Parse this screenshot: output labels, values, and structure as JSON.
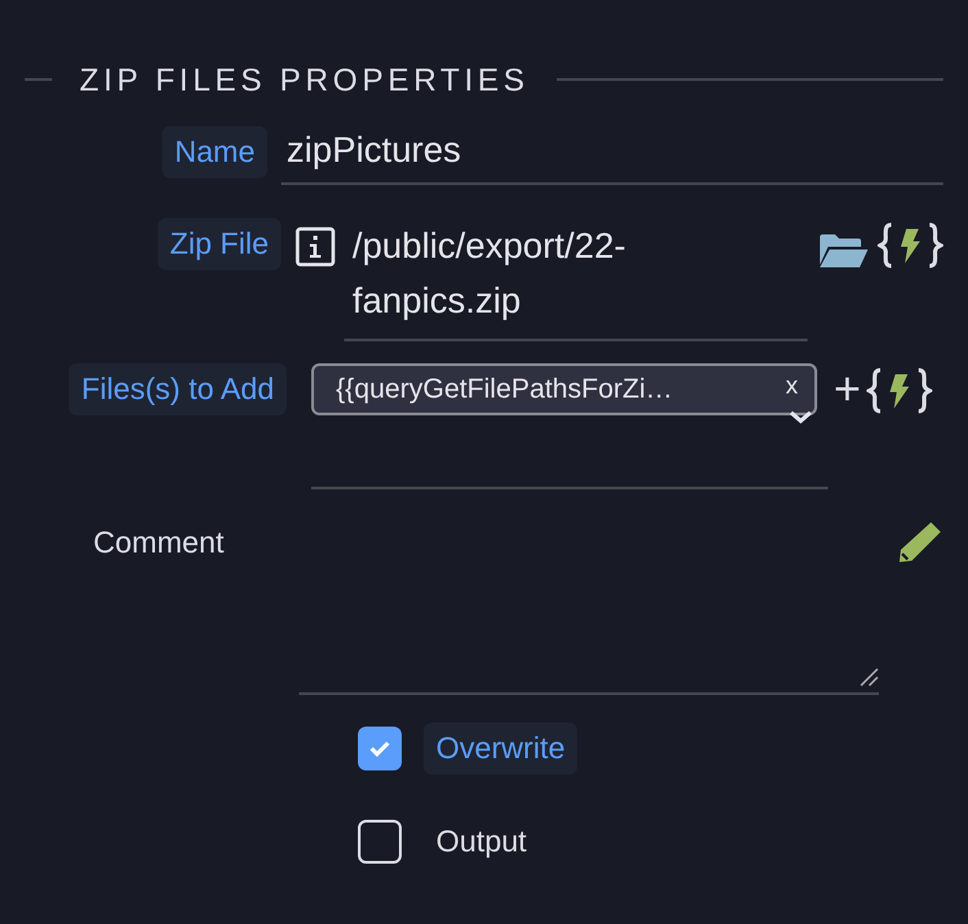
{
  "section": {
    "title": "ZIP FILES PROPERTIES"
  },
  "name_field": {
    "label": "Name",
    "highlighted": true,
    "value": "zipPictures"
  },
  "zip_file_field": {
    "label": "Zip File",
    "highlighted": true,
    "value": "/public/export/22-fanpics.zip"
  },
  "files_field": {
    "label": "Files(s) to Add",
    "highlighted": true,
    "chips": [
      {
        "text": "{{queryGetFilePathsForZi…",
        "remove": "x"
      }
    ],
    "add": "+"
  },
  "comment_field": {
    "label": "Comment",
    "highlighted": false
  },
  "checkboxes": [
    {
      "label": "Overwrite",
      "checked": true
    },
    {
      "label": "Output",
      "checked": false
    }
  ]
}
